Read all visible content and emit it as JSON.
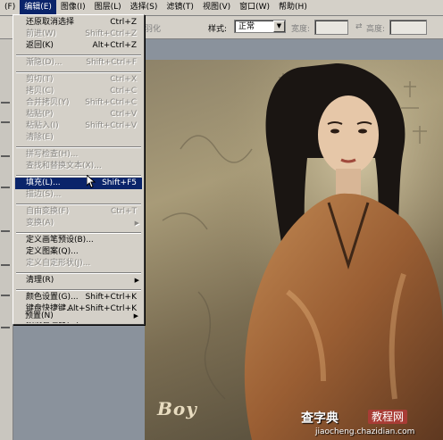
{
  "menubar": {
    "items": [
      "编辑(E)",
      "图像(I)",
      "图层(L)",
      "选择(S)",
      "滤镜(T)",
      "视图(V)",
      "窗口(W)",
      "帮助(H)"
    ],
    "partial_left": "(F)"
  },
  "options": {
    "feather_label": "羽化",
    "style_label": "样式:",
    "style_value": "正常",
    "width_label": "宽度:",
    "height_label": "高度:"
  },
  "edit_menu": [
    {
      "label": "还原取消选择",
      "shortcut": "Ctrl+Z",
      "enabled": true
    },
    {
      "label": "前进(W)",
      "shortcut": "Shift+Ctrl+Z",
      "enabled": false
    },
    {
      "label": "返回(K)",
      "shortcut": "Alt+Ctrl+Z",
      "enabled": true
    },
    {
      "label": "渐隐(D)...",
      "shortcut": "Shift+Ctrl+F",
      "enabled": false
    },
    {
      "label": "剪切(T)",
      "shortcut": "Ctrl+X",
      "enabled": false
    },
    {
      "label": "拷贝(C)",
      "shortcut": "Ctrl+C",
      "enabled": false
    },
    {
      "label": "合并拷贝(Y)",
      "shortcut": "Shift+Ctrl+C",
      "enabled": false
    },
    {
      "label": "粘贴(P)",
      "shortcut": "Ctrl+V",
      "enabled": false
    },
    {
      "label": "粘贴入(I)",
      "shortcut": "Shift+Ctrl+V",
      "enabled": false
    },
    {
      "label": "清除(E)",
      "shortcut": "",
      "enabled": false
    },
    {
      "label": "拼写检查(H)...",
      "shortcut": "",
      "enabled": false
    },
    {
      "label": "查找和替换文本(X)...",
      "shortcut": "",
      "enabled": false
    },
    {
      "label": "填充(L)...",
      "shortcut": "Shift+F5",
      "enabled": true,
      "highlighted": true
    },
    {
      "label": "描边(S)...",
      "shortcut": "",
      "enabled": false
    },
    {
      "label": "自由变换(F)",
      "shortcut": "Ctrl+T",
      "enabled": false
    },
    {
      "label": "变换(A)",
      "shortcut": "",
      "enabled": false,
      "submenu": true
    },
    {
      "label": "定义画笔预设(B)...",
      "shortcut": "",
      "enabled": true
    },
    {
      "label": "定义图案(Q)...",
      "shortcut": "",
      "enabled": true
    },
    {
      "label": "定义自定形状(J)...",
      "shortcut": "",
      "enabled": false
    },
    {
      "label": "清理(R)",
      "shortcut": "",
      "enabled": true,
      "submenu": true
    },
    {
      "label": "颜色设置(G)...",
      "shortcut": "Shift+Ctrl+K",
      "enabled": true
    },
    {
      "label": "键盘快捷键...",
      "shortcut": "Alt+Shift+Ctrl+K",
      "enabled": true
    },
    {
      "label": "预设管理器(M)...",
      "shortcut": "",
      "enabled": true
    },
    {
      "label": "预置(N)",
      "shortcut": "",
      "enabled": true,
      "submenu": true
    }
  ],
  "watermark": {
    "site": "查字典",
    "badge": "教程网",
    "url": "jiaocheng.chazidian.com"
  },
  "logo": "Boy"
}
